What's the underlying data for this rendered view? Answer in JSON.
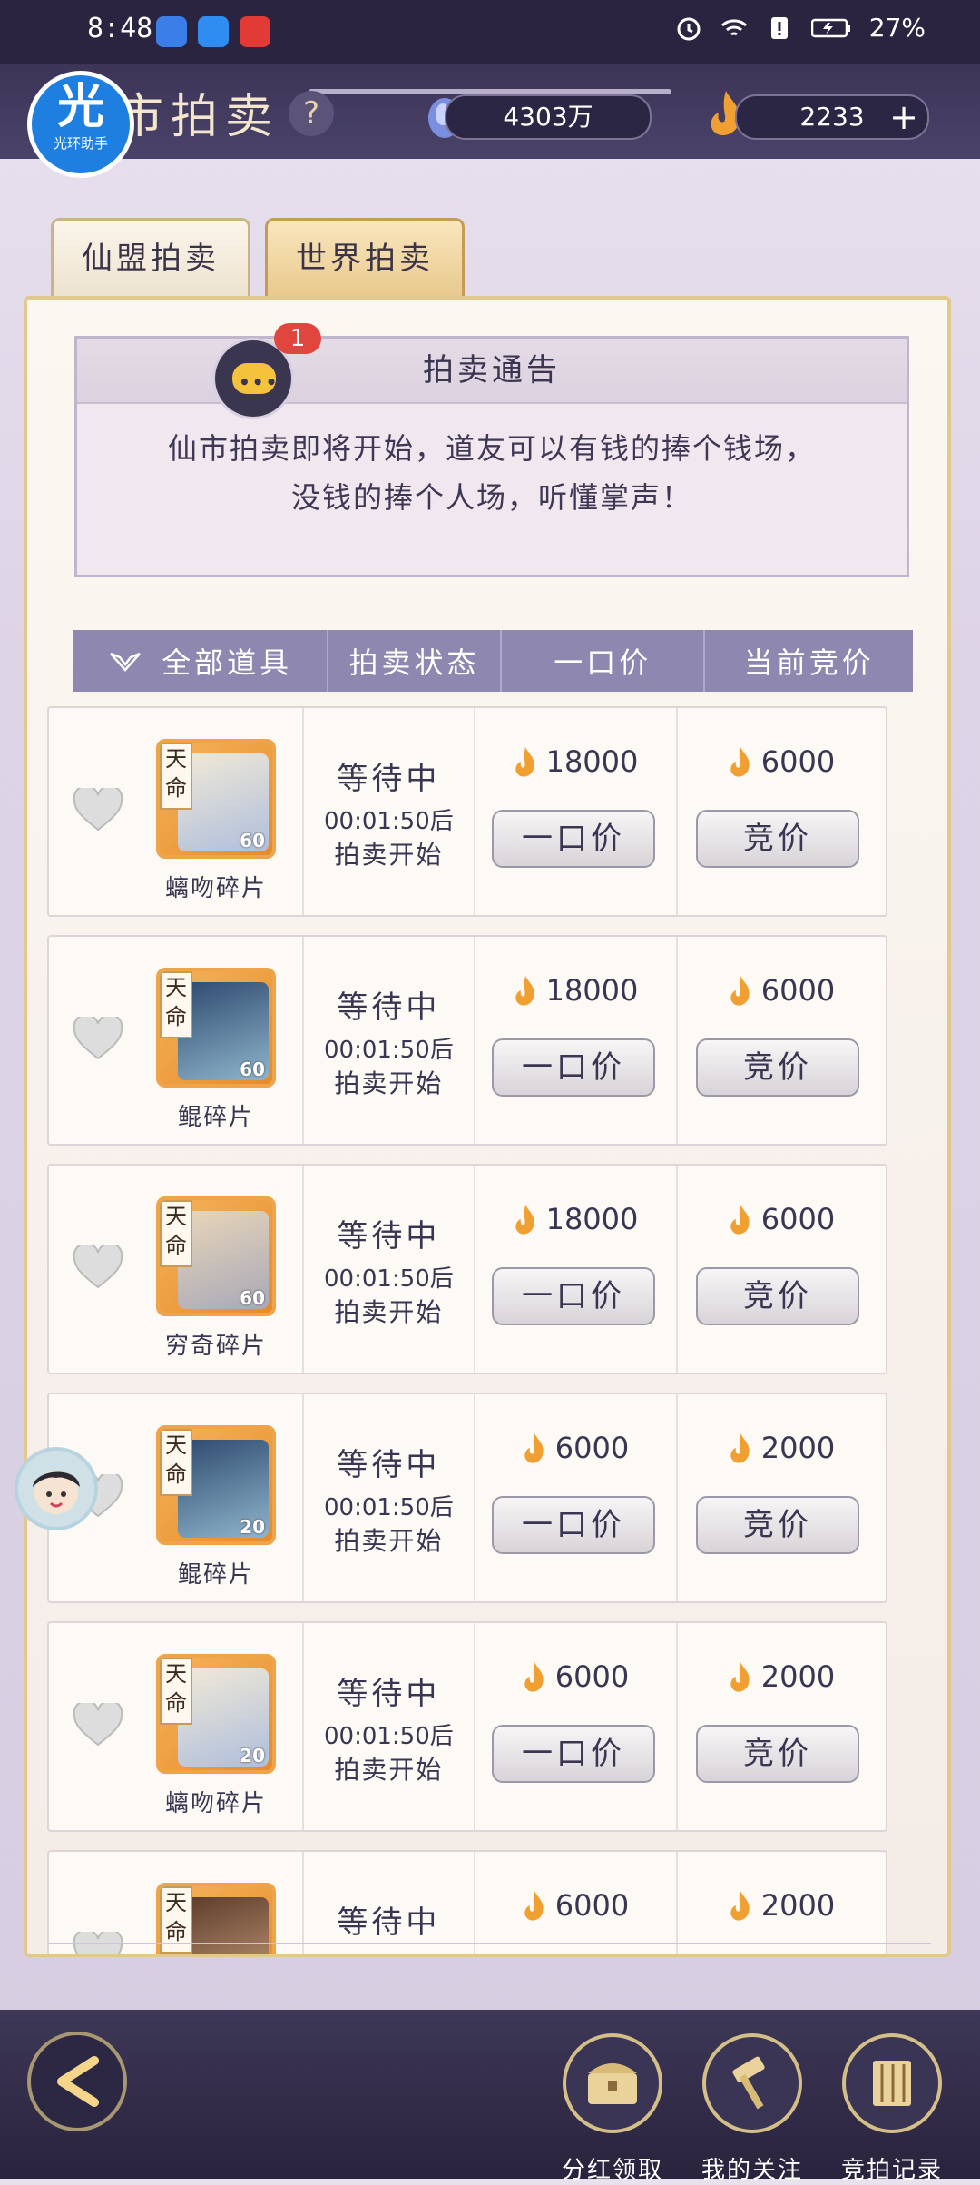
{
  "status_bar": {
    "time": "8:48",
    "battery": "27%"
  },
  "header": {
    "title": "市拍卖",
    "help_label": "?",
    "logo": {
      "big": "光",
      "small": "光环助手"
    },
    "spirit_stone": "4303万",
    "gold": "2233",
    "plus_label": "+"
  },
  "tabs": [
    {
      "label": "仙盟拍卖",
      "active": false
    },
    {
      "label": "世界拍卖",
      "active": true
    }
  ],
  "notice": {
    "title": "拍卖通告",
    "badge": "1",
    "line1": "仙市拍卖即将开始，道友可以有钱的捧个钱场，",
    "line2": "没钱的捧个人场，听懂掌声！"
  },
  "table_header": {
    "col1": "全部道具",
    "col2": "拍卖状态",
    "col3": "一口价",
    "col4": "当前竞价"
  },
  "rows": [
    {
      "tag": "天命",
      "level": "60",
      "name": "螭吻碎片",
      "status": "等待中",
      "time": "00:01:50后",
      "sub": "拍卖开始",
      "buyout": "18000",
      "bid": "6000",
      "buyout_btn": "一口价",
      "bid_btn": "竞价"
    },
    {
      "tag": "天命",
      "level": "60",
      "name": "鲲碎片",
      "status": "等待中",
      "time": "00:01:50后",
      "sub": "拍卖开始",
      "buyout": "18000",
      "bid": "6000",
      "buyout_btn": "一口价",
      "bid_btn": "竞价"
    },
    {
      "tag": "天命",
      "level": "60",
      "name": "穷奇碎片",
      "status": "等待中",
      "time": "00:01:50后",
      "sub": "拍卖开始",
      "buyout": "18000",
      "bid": "6000",
      "buyout_btn": "一口价",
      "bid_btn": "竞价"
    },
    {
      "tag": "天命",
      "level": "20",
      "name": "鲲碎片",
      "status": "等待中",
      "time": "00:01:50后",
      "sub": "拍卖开始",
      "buyout": "6000",
      "bid": "2000",
      "buyout_btn": "一口价",
      "bid_btn": "竞价"
    },
    {
      "tag": "天命",
      "level": "20",
      "name": "螭吻碎片",
      "status": "等待中",
      "time": "00:01:50后",
      "sub": "拍卖开始",
      "buyout": "6000",
      "bid": "2000",
      "buyout_btn": "一口价",
      "bid_btn": "竞价"
    },
    {
      "tag": "天命",
      "level": "",
      "name": "",
      "status": "等待中",
      "time": "",
      "sub": "",
      "buyout": "6000",
      "bid": "2000",
      "buyout_btn": "",
      "bid_btn": ""
    }
  ],
  "bottom": {
    "btn1": "分红领取",
    "btn2": "我的关注",
    "btn3": "竞拍记录"
  },
  "colors": {
    "gold": "#f0a44a",
    "header_bg": "#3c3558",
    "table_head": "#8e87b0"
  }
}
